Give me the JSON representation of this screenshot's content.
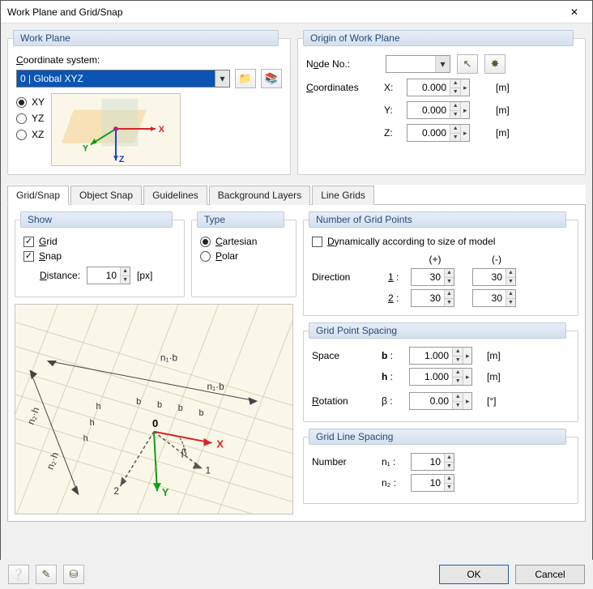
{
  "title": "Work Plane and Grid/Snap",
  "close_glyph": "✕",
  "work_plane": {
    "legend": "Work Plane",
    "coord_label": "Coordinate system:",
    "coord_value": "0 | Global XYZ",
    "radio_XY": "XY",
    "radio_YZ": "YZ",
    "radio_XZ": "XZ",
    "plane_selected": "XY"
  },
  "icons": {
    "folder_new": "📁",
    "library": "📚",
    "pick": "↖",
    "node_new": "✸",
    "help": "❔",
    "edit": "✎",
    "units": "⛁"
  },
  "origin": {
    "legend": "Origin of Work Plane",
    "node_label": "Node No.:",
    "node_value": "",
    "coordinates_label": "Coordinates",
    "x_label": "X:",
    "x_val": "0.000",
    "x_unit": "[m]",
    "y_label": "Y:",
    "y_val": "0.000",
    "y_unit": "[m]",
    "z_label": "Z:",
    "z_val": "0.000",
    "z_unit": "[m]"
  },
  "tabs": {
    "gridsnap": "Grid/Snap",
    "objectsnap": "Object Snap",
    "guidelines": "Guidelines",
    "bglayers": "Background Layers",
    "linegrids": "Line Grids",
    "active": "gridsnap"
  },
  "show": {
    "legend": "Show",
    "grid": "Grid",
    "snap": "Snap",
    "distance_label": "Distance:",
    "distance_value": "10",
    "distance_unit": "[px]"
  },
  "type": {
    "legend": "Type",
    "cartesian": "Cartesian",
    "polar": "Polar",
    "selected": "cartesian"
  },
  "gridpoints": {
    "legend": "Number of Grid Points",
    "dynamic_label": "Dynamically according to size of model",
    "direction_label": "Direction",
    "plus": "(+)",
    "minus": "(-)",
    "d1_label": "1 :",
    "d1_plus": "30",
    "d1_minus": "30",
    "d2_label": "2 :",
    "d2_plus": "30",
    "d2_minus": "30"
  },
  "spacing": {
    "legend": "Grid Point Spacing",
    "space_label": "Space",
    "b_label": "b :",
    "b_val": "1.000",
    "b_unit": "[m]",
    "h_label": "h :",
    "h_val": "1.000",
    "h_unit": "[m]",
    "rotation_label": "Rotation",
    "beta_label": "β :",
    "beta_val": "0.00",
    "beta_unit": "[°]"
  },
  "gridline": {
    "legend": "Grid Line Spacing",
    "number_label": "Number",
    "n1_label": "n₁ :",
    "n1_val": "10",
    "n2_label": "n₂ :",
    "n2_val": "10"
  },
  "buttons": {
    "ok": "OK",
    "cancel": "Cancel"
  },
  "diagram_labels": {
    "n1b": "n₁·b",
    "n2h": "n₂·h",
    "b": "b",
    "h": "h",
    "origin": "0",
    "x": "X",
    "y": "Y",
    "one": "1",
    "two": "2",
    "beta": "β"
  }
}
